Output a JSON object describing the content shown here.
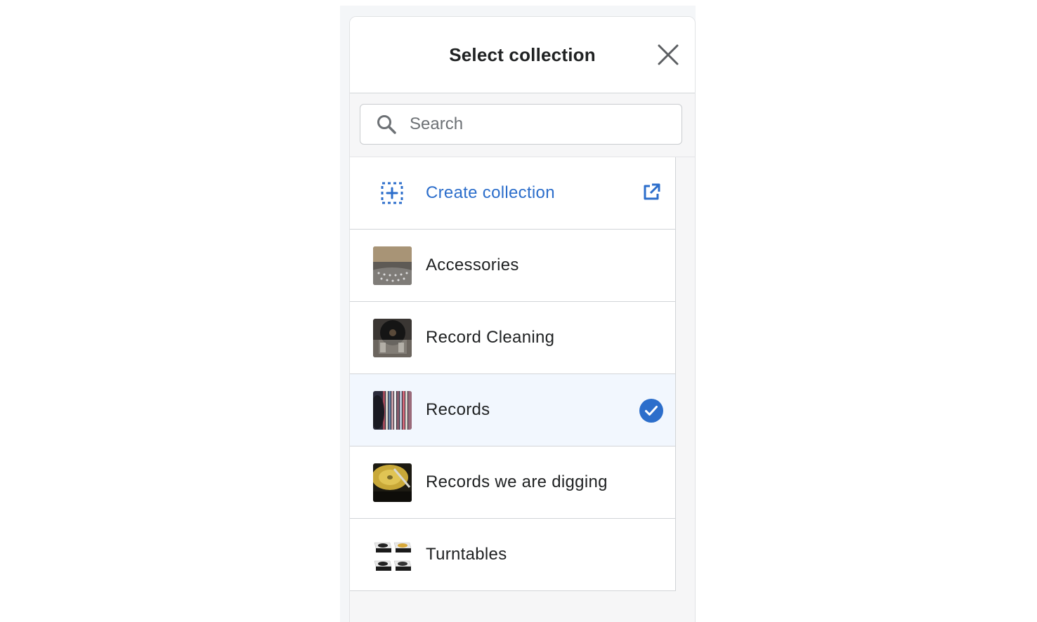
{
  "modal": {
    "title": "Select collection",
    "close_icon": "close-icon"
  },
  "search": {
    "placeholder": "Search",
    "value": "",
    "icon": "search-icon"
  },
  "create": {
    "label": "Create collection",
    "icon": "dashed-plus-icon",
    "external_icon": "external-link-icon"
  },
  "collections": [
    {
      "label": "Accessories",
      "thumb": "turntable-platter-photo",
      "selected": false
    },
    {
      "label": "Record Cleaning",
      "thumb": "vinyl-record-photo",
      "selected": false
    },
    {
      "label": "Records",
      "thumb": "record-sleeves-photo",
      "selected": true
    },
    {
      "label": "Records we are digging",
      "thumb": "gold-turntable-photo",
      "selected": false
    },
    {
      "label": "Turntables",
      "thumb": "turntables-grid-photo",
      "selected": false
    }
  ],
  "colors": {
    "accent": "#2c6ecb",
    "selected_bg": "#f2f7fe",
    "text": "#202223",
    "border": "#d2d5d8"
  }
}
